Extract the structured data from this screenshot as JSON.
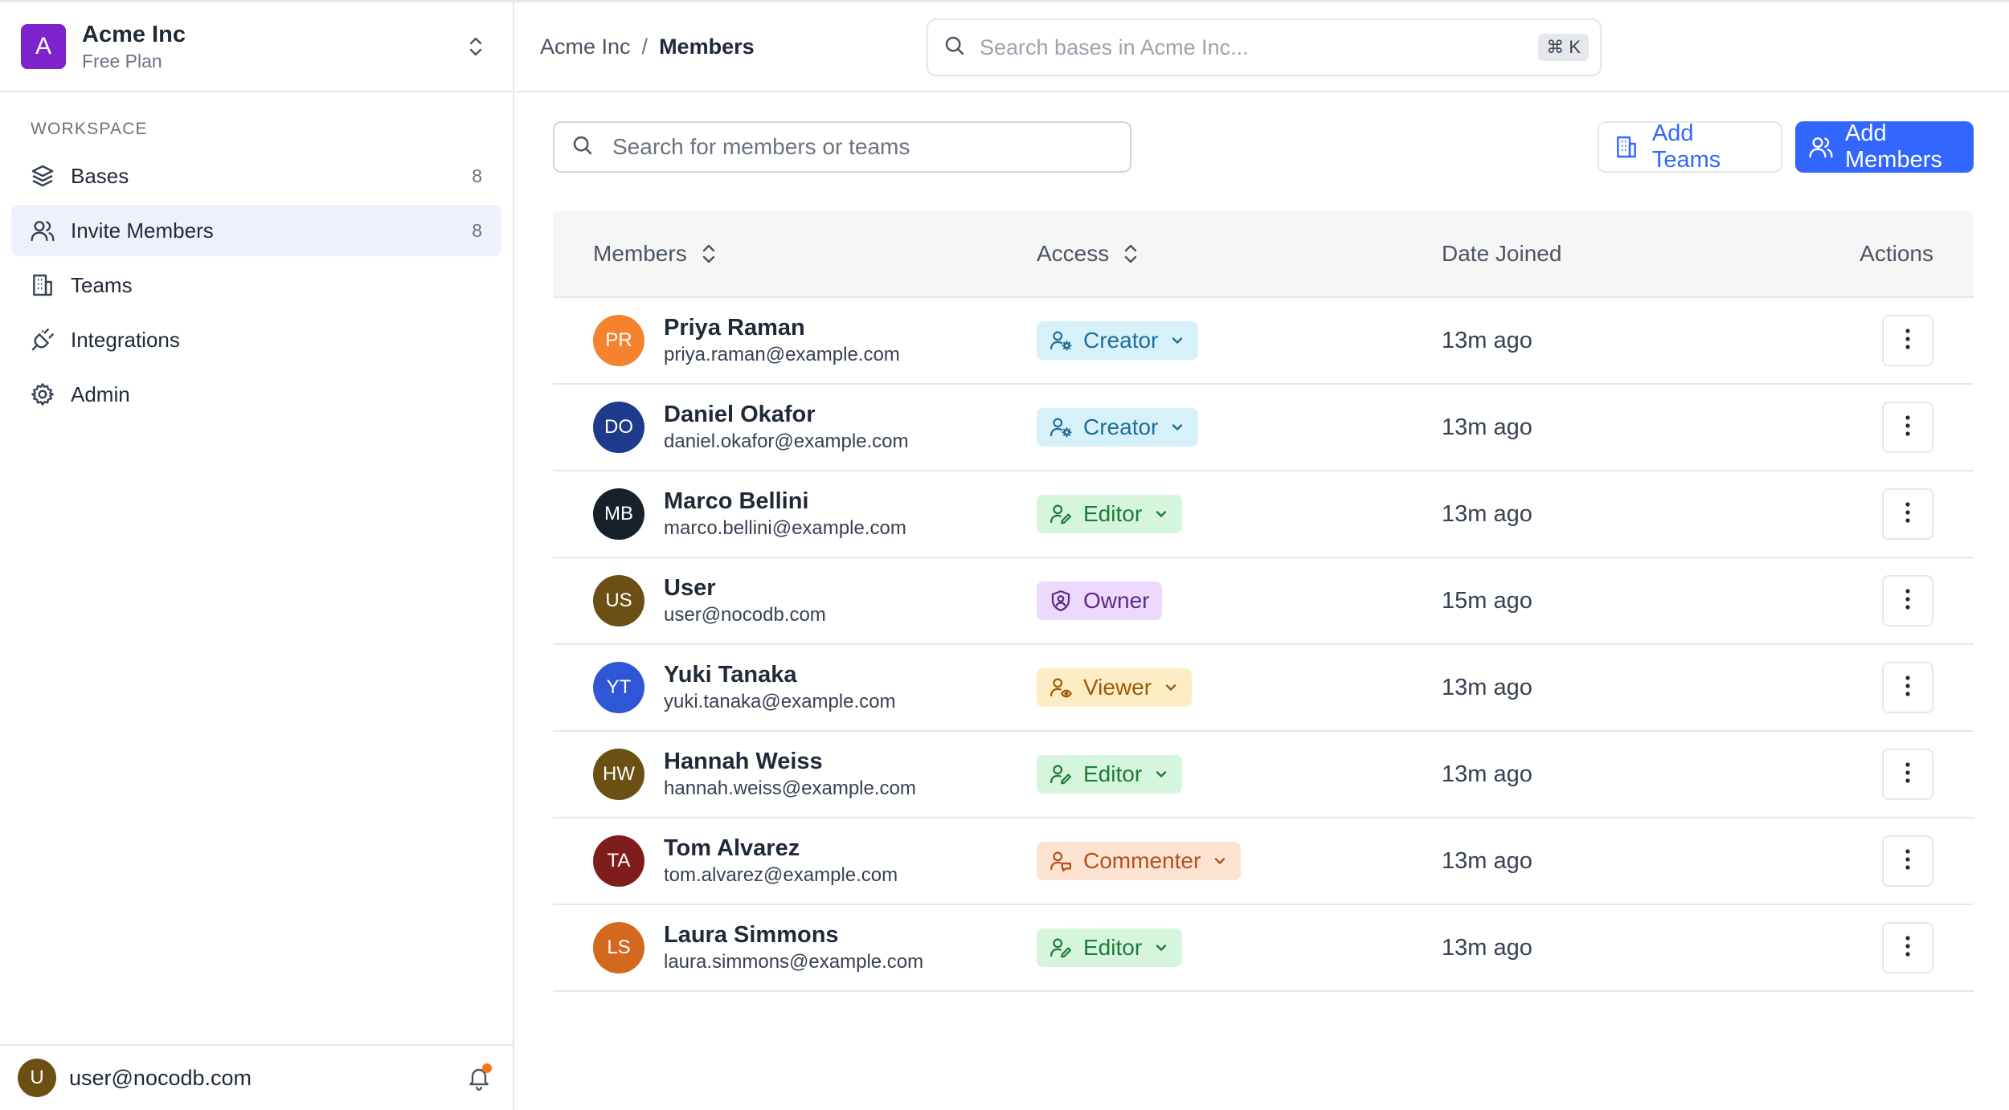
{
  "workspace": {
    "initial": "A",
    "name": "Acme Inc",
    "plan": "Free Plan"
  },
  "sidebar": {
    "section_label": "WORKSPACE",
    "items": [
      {
        "label": "Bases",
        "count": "8",
        "icon": "layers-icon"
      },
      {
        "label": "Invite Members",
        "count": "8",
        "icon": "users-icon",
        "active": true
      },
      {
        "label": "Teams",
        "count": "",
        "icon": "building-icon"
      },
      {
        "label": "Integrations",
        "count": "",
        "icon": "plug-icon"
      },
      {
        "label": "Admin",
        "count": "",
        "icon": "gear-icon"
      }
    ],
    "footer": {
      "avatar_initial": "U",
      "email": "user@nocodb.com"
    }
  },
  "topbar": {
    "breadcrumb_root": "Acme Inc",
    "breadcrumb_sep": "/",
    "breadcrumb_current": "Members",
    "search_placeholder": "Search bases in Acme Inc...",
    "shortcut": "⌘ K"
  },
  "toolbar": {
    "search_placeholder": "Search for members or teams",
    "add_teams_label": "Add Teams",
    "add_members_label": "Add Members"
  },
  "table": {
    "headers": {
      "members": "Members",
      "access": "Access",
      "date_joined": "Date Joined",
      "actions": "Actions"
    },
    "rows": [
      {
        "initials": "PR",
        "avatar_color": "#f5822f",
        "name": "Priya Raman",
        "email": "priya.raman@example.com",
        "role": "Creator",
        "role_key": "creator",
        "dropdown": true,
        "joined": "13m ago"
      },
      {
        "initials": "DO",
        "avatar_color": "#1e3a8a",
        "name": "Daniel Okafor",
        "email": "daniel.okafor@example.com",
        "role": "Creator",
        "role_key": "creator",
        "dropdown": true,
        "joined": "13m ago"
      },
      {
        "initials": "MB",
        "avatar_color": "#16212b",
        "name": "Marco Bellini",
        "email": "marco.bellini@example.com",
        "role": "Editor",
        "role_key": "editor",
        "dropdown": true,
        "joined": "13m ago"
      },
      {
        "initials": "US",
        "avatar_color": "#6b4f13",
        "name": "User",
        "email": "user@nocodb.com",
        "role": "Owner",
        "role_key": "owner",
        "dropdown": false,
        "joined": "15m ago"
      },
      {
        "initials": "YT",
        "avatar_color": "#2f56d4",
        "name": "Yuki Tanaka",
        "email": "yuki.tanaka@example.com",
        "role": "Viewer",
        "role_key": "viewer",
        "dropdown": true,
        "joined": "13m ago"
      },
      {
        "initials": "HW",
        "avatar_color": "#6b4f13",
        "name": "Hannah Weiss",
        "email": "hannah.weiss@example.com",
        "role": "Editor",
        "role_key": "editor",
        "dropdown": true,
        "joined": "13m ago"
      },
      {
        "initials": "TA",
        "avatar_color": "#7f1d1d",
        "name": "Tom Alvarez",
        "email": "tom.alvarez@example.com",
        "role": "Commenter",
        "role_key": "commenter",
        "dropdown": true,
        "joined": "13m ago"
      },
      {
        "initials": "LS",
        "avatar_color": "#d2691e",
        "name": "Laura Simmons",
        "email": "laura.simmons@example.com",
        "role": "Editor",
        "role_key": "editor",
        "dropdown": true,
        "joined": "13m ago"
      }
    ]
  },
  "colors": {
    "accent": "#3366ff",
    "workspace_avatar": "#7e22ce",
    "notification_dot": "#f97316"
  }
}
